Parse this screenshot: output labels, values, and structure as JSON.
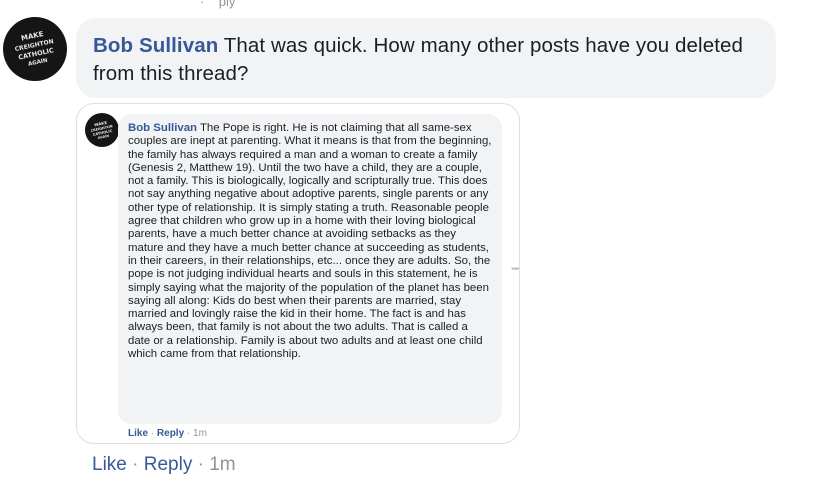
{
  "comment": {
    "author": "Bob Sullivan",
    "text": "That was quick. How many other posts have you deleted from this thread?",
    "actions": {
      "like": "Like",
      "reply": "Reply",
      "time": "1m"
    },
    "avatar_text": [
      "MAKE",
      "CREIGHTON",
      "CATHOLIC",
      "AGAIN"
    ]
  },
  "shared_comment": {
    "author": "Bob Sullivan",
    "text": "The Pope is right. He is not claiming that all same-sex couples are inept at parenting. What it means is that from the beginning, the family has always required a man and a woman to create a family (Genesis 2, Matthew 19). Until the two have a child, they are a couple, not a family. This is biologically, logically and scripturally true. This does not say anything negative about adoptive parents, single parents or any other type of relationship. It is simply stating a truth. Reasonable people agree that children who grow up in a home with their loving biological parents, have a much better chance at avoiding setbacks as they mature and they have a much better chance at succeeding as students, in their careers, in their relationships, etc... once they are adults. So, the pope is not judging individual hearts and souls in this statement, he is simply saying what the majority of the population of the planet has been saying all along: Kids do best when their parents are married, stay married and lovingly raise the kid in their home. The fact is and has always been, that family is not about the two adults. That is called a date or a relationship. Family is about two adults and at least one child which came from that relationship.",
    "actions": {
      "like": "Like",
      "reply": "Reply",
      "time": "1m"
    }
  },
  "colors": {
    "link": "#385898",
    "bubble": "#f2f3f5",
    "meta": "#90949c"
  }
}
